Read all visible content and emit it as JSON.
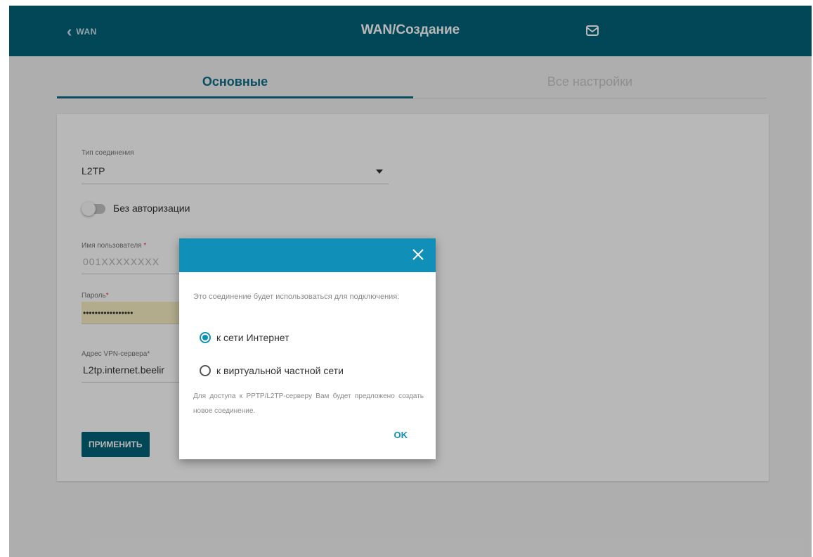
{
  "header": {
    "back_label": "WAN",
    "title": "WAN/Создание",
    "back_icon": "chevron-left-icon",
    "mail_icon": "envelope-icon"
  },
  "tabs": [
    {
      "label": "Основные",
      "active": true
    },
    {
      "label": "Все настройки",
      "active": false
    }
  ],
  "form": {
    "connection_type": {
      "label": "Тип соединения",
      "value": "L2TP"
    },
    "no_auth": {
      "label": "Без авторизации",
      "enabled": false
    },
    "username": {
      "label": "Имя пользователя",
      "value": "001XXXXXXXX"
    },
    "password": {
      "label": "Пароль",
      "value": "•••••••••••••••••"
    },
    "vpn_server": {
      "label": "Адрес VPN-сервера",
      "value": "L2tp.internet.beelir"
    },
    "apply_label": "ПРИМЕНИТЬ"
  },
  "dialog": {
    "message": "Это соединение будет использоваться для подключения:",
    "options": [
      {
        "label": "к сети Интернет",
        "selected": true
      },
      {
        "label": "к виртуальной частной сети",
        "selected": false
      }
    ],
    "hint": "Для доступа к PPTP/L2TP-серверу Вам будет предложено создать новое соединение.",
    "ok_label": "OK"
  },
  "colors": {
    "header_bg": "#03637b",
    "dialog_header_bg": "#1090b8",
    "accent": "#0e6e87",
    "required": "#e0334b"
  }
}
